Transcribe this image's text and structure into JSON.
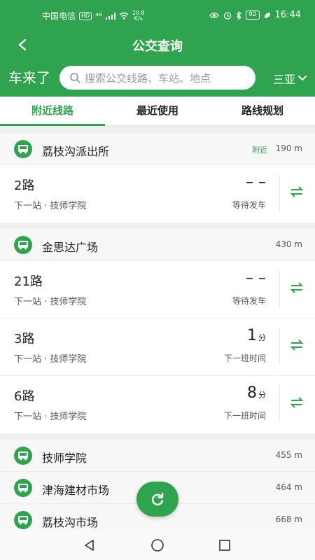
{
  "status_bar": {
    "carrier": "中国电信",
    "hd_tag": "HD",
    "signal_label": "⁴⁶",
    "speed_value": "20.8",
    "speed_unit": "K/s",
    "battery": "92",
    "time": "16:44"
  },
  "title_bar": {
    "title": "公交查询"
  },
  "search": {
    "brand": "车来了",
    "placeholder": "搜索公交线路、车站、地点",
    "city": "三亚"
  },
  "tabs": [
    {
      "label": "附近线路",
      "active": true
    },
    {
      "label": "最近使用",
      "active": false
    },
    {
      "label": "路线规划",
      "active": false
    }
  ],
  "stations": [
    {
      "name": "荔枝沟派出所",
      "tag": "附近",
      "distance": "190 m",
      "routes": [
        {
          "name": "2路",
          "next": "下一站 · 技师学院",
          "eta": "– –",
          "unit": "",
          "status": "等待发车"
        }
      ]
    },
    {
      "name": "金思达广场",
      "tag": "",
      "distance": "430 m",
      "routes": [
        {
          "name": "21路",
          "next": "下一站 · 技师学院",
          "eta": "– –",
          "unit": "",
          "status": "等待发车"
        },
        {
          "name": "3路",
          "next": "下一站 · 技师学院",
          "eta": "1",
          "unit": "分",
          "status": "下一班时间"
        },
        {
          "name": "6路",
          "next": "下一站 · 技师学院",
          "eta": "8",
          "unit": "分",
          "status": "下一班时间"
        }
      ]
    }
  ],
  "other_stations": [
    {
      "name": "技师学院",
      "distance": "455 m"
    },
    {
      "name": "津海建材市场",
      "distance": "464 m"
    },
    {
      "name": "荔枝沟市场",
      "distance": "668 m"
    }
  ],
  "colors": {
    "accent": "#2fa34e"
  },
  "icons": {
    "back": "back-arrow-icon",
    "search": "search-icon",
    "station": "bus-station-icon",
    "swap": "swap-arrows-icon",
    "refresh": "refresh-icon"
  }
}
